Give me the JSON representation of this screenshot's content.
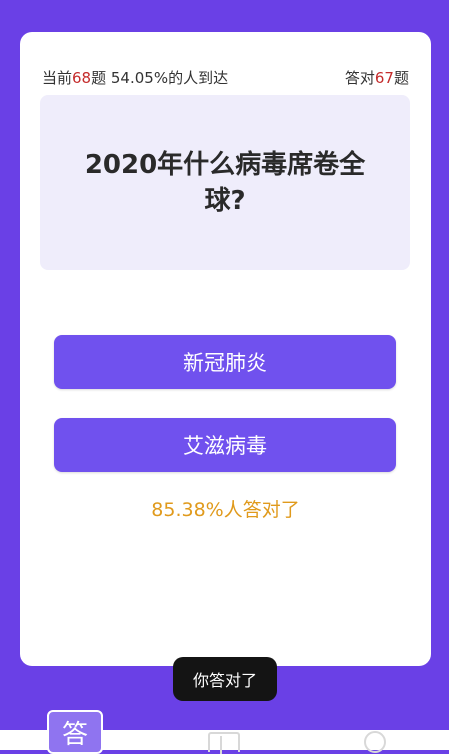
{
  "stats": {
    "current_prefix": "当前",
    "current_number": "68",
    "current_suffix": "题 54.05%的人到达",
    "correct_prefix": "答对",
    "correct_number": "67",
    "correct_suffix": "题"
  },
  "question": {
    "text": "2020年什么病毒席卷全球?"
  },
  "options": [
    {
      "label": "新冠肺炎"
    },
    {
      "label": "艾滋病毒"
    }
  ],
  "result": {
    "rate_text": "85.38%人答对了"
  },
  "toast": {
    "text": "你答对了"
  },
  "bottom_nav": {
    "answer_label": "答",
    "items": [
      "answer-icon",
      "book-icon",
      "user-icon"
    ]
  },
  "colors": {
    "background": "#6a40e6",
    "option": "#7051ee",
    "highlight_number": "#c42b2b",
    "rate": "#e09a1c"
  }
}
